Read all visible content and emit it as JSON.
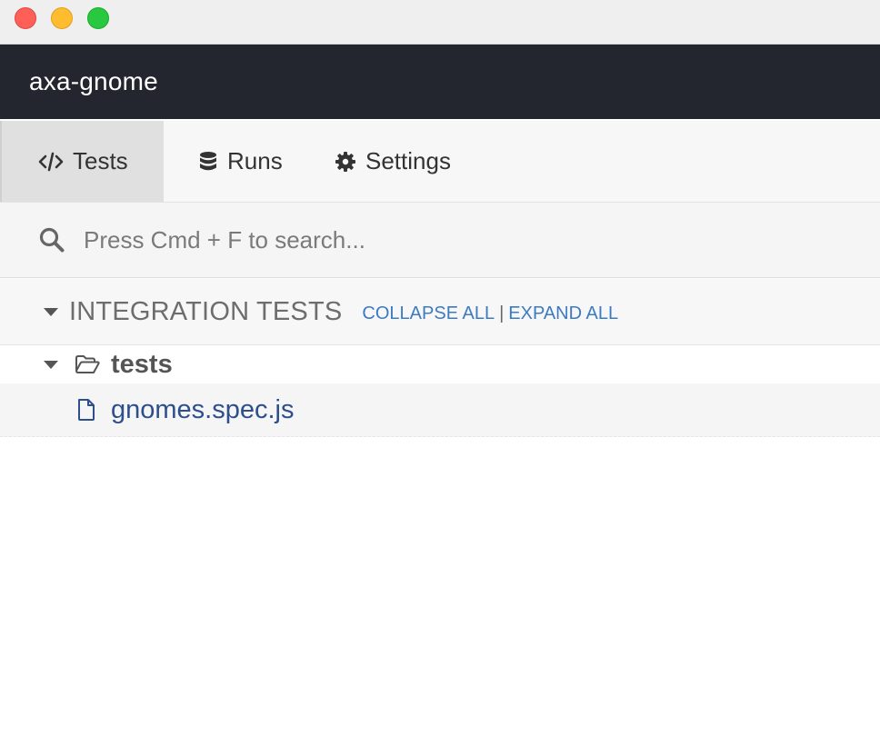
{
  "window": {
    "controls": [
      "close",
      "minimize",
      "maximize"
    ],
    "colors": {
      "close": "#fe5f57",
      "minimize": "#febc2e",
      "maximize": "#28c840"
    }
  },
  "header": {
    "project_name": "axa-gnome",
    "background": "#23262f"
  },
  "tabs": [
    {
      "label": "Tests",
      "icon": "code-icon",
      "active": true
    },
    {
      "label": "Runs",
      "icon": "database-icon",
      "active": false
    },
    {
      "label": "Settings",
      "icon": "gear-icon",
      "active": false
    }
  ],
  "search": {
    "placeholder": "Press Cmd + F to search...",
    "value": "",
    "icon": "search-icon"
  },
  "specs": {
    "section_title": "INTEGRATION TESTS",
    "collapse_all": "COLLAPSE ALL",
    "separator": "|",
    "expand_all": "EXPAND ALL",
    "link_color": "#3c7bc2",
    "tree": {
      "folder": {
        "name": "tests",
        "icon": "folder-open-icon",
        "expanded": true
      },
      "files": [
        {
          "name": "gnomes.spec.js",
          "icon": "file-icon"
        }
      ]
    }
  }
}
